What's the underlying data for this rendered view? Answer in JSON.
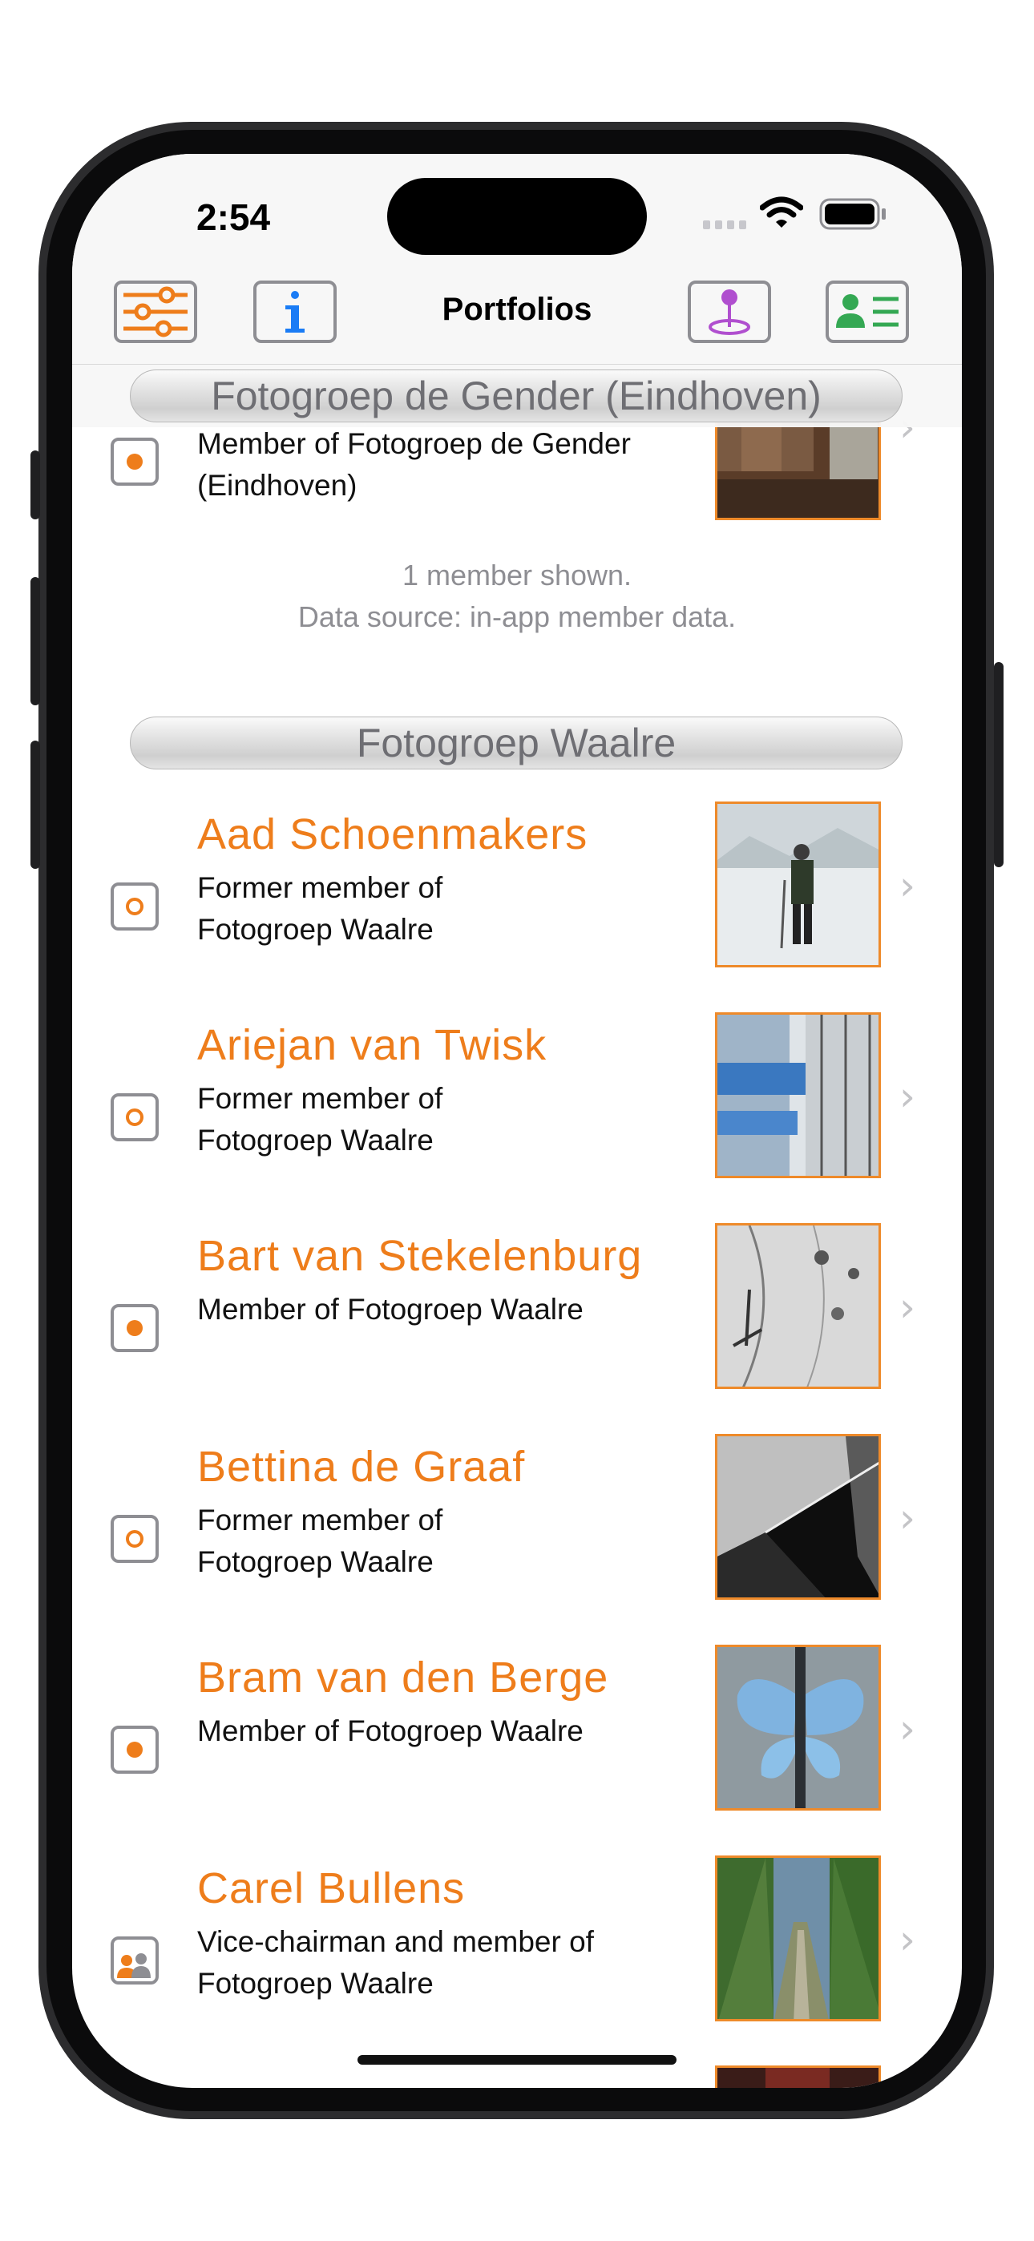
{
  "status_bar": {
    "time": "2:54"
  },
  "nav": {
    "title": "Portfolios"
  },
  "sections": [
    {
      "title": "Fotogroep de Gender (Eindhoven)"
    },
    {
      "title": "Fotogroep Waalre"
    }
  ],
  "partial_member": {
    "role": "Member of Fotogroep de Gender (Eindhoven)",
    "status": "member"
  },
  "footer": {
    "line1": "1 member shown.",
    "line2": "Data source: in-app member data."
  },
  "members": [
    {
      "name": "Aad Schoenmakers",
      "role": "Former member of Fotogroep Waalre",
      "status": "former",
      "thumb": "person-in-snow"
    },
    {
      "name": "Ariejan van Twisk",
      "role": "Former member of Fotogroep Waalre",
      "status": "former",
      "thumb": "glass-building"
    },
    {
      "name": "Bart van Stekelenburg",
      "role": "Member of Fotogroep Waalre",
      "status": "member",
      "thumb": "snow-pattern"
    },
    {
      "name": "Bettina de Graaf",
      "role": "Former member of Fotogroep Waalre",
      "status": "former",
      "thumb": "dark-corridor"
    },
    {
      "name": "Bram van den Berge",
      "role": "Member of Fotogroep Waalre",
      "status": "member",
      "thumb": "blue-butterfly-sculpture"
    },
    {
      "name": "Carel Bullens",
      "role": "Vice-chairman and member of Fotogroep Waalre",
      "status": "board",
      "thumb": "tree-lined-path"
    }
  ],
  "colors": {
    "accent": "#ee7d1b",
    "icon_gray": "#8e8e93",
    "info_blue": "#1a7cf5",
    "map_purple": "#b04fcf",
    "contact_green": "#34a853"
  },
  "icons": {
    "filter": "sliders-icon",
    "info": "info-icon",
    "map": "map-pin-icon",
    "contacts": "contact-card-icon",
    "former": "hollow-dot-icon",
    "member": "filled-dot-icon",
    "board": "people-icon"
  }
}
